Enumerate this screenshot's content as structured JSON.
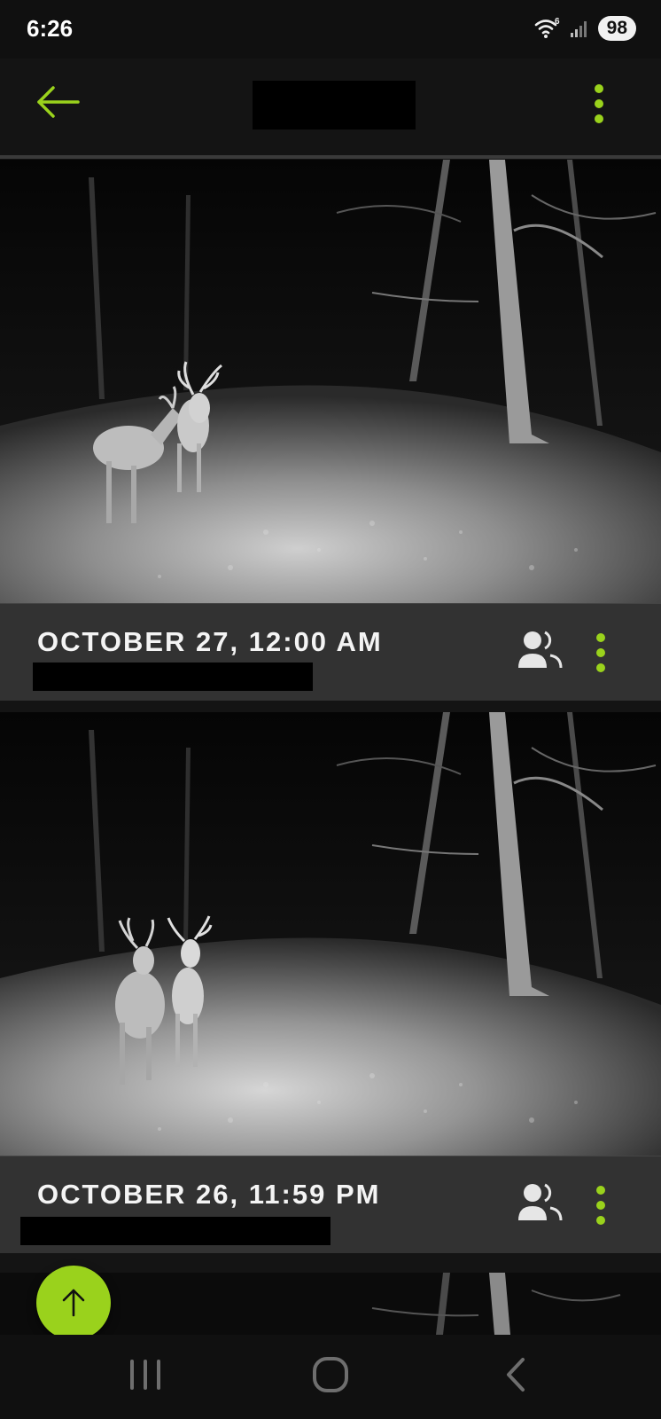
{
  "status_bar": {
    "time": "6:26",
    "wifi_badge": "6",
    "battery": "98",
    "icons": [
      "wifi-icon",
      "signal-icon",
      "battery-icon"
    ]
  },
  "app_bar": {
    "back_icon": "arrow-left-icon",
    "menu_icon": "more-vertical-icon",
    "accent_color": "#9ad21c"
  },
  "photos": [
    {
      "date": "OCTOBER 27, 12:00 AM",
      "icons": [
        "people-icon",
        "more-vertical-icon"
      ]
    },
    {
      "date": "OCTOBER 26, 11:59 PM",
      "icons": [
        "people-icon",
        "more-vertical-icon"
      ]
    }
  ],
  "fab": {
    "icon": "arrow-up-icon",
    "color": "#9ad21c"
  },
  "nav_bar": {
    "icons": [
      "recent-apps-icon",
      "home-icon",
      "back-icon"
    ]
  }
}
